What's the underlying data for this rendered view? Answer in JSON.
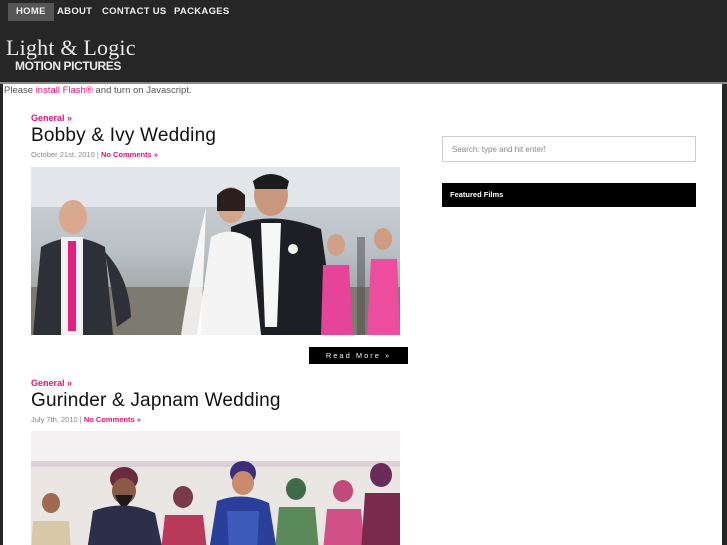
{
  "nav": {
    "items": [
      {
        "label": "HOME",
        "active": true
      },
      {
        "label": "ABOUT",
        "active": false
      },
      {
        "label": "CONTACT US",
        "active": false
      },
      {
        "label": "PACKAGES",
        "active": false
      }
    ]
  },
  "brand": {
    "line1": "Light & Logic",
    "line2": "MOTION PICTURES"
  },
  "flash_notice": {
    "prefix": "Please ",
    "link": "install Flash®",
    "suffix": " and turn on Javascript."
  },
  "posts": [
    {
      "category": "General »",
      "title": "Bobby & Ivy Wedding",
      "date": "October 21st, 2010",
      "separator": "|",
      "comments": "No Comments »",
      "read_more": "Read More »"
    },
    {
      "category": "General »",
      "title": "Gurinder & Japnam Wedding",
      "date": "July 7th, 2010",
      "separator": "|",
      "comments": "No Comments »"
    }
  ],
  "sidebar": {
    "search_placeholder": "Search: type and hit enter!",
    "featured_title": "Featured Films"
  },
  "colors": {
    "accent": "#e0157a",
    "header_bg": "#262626",
    "page_bg": "#ffffff"
  }
}
